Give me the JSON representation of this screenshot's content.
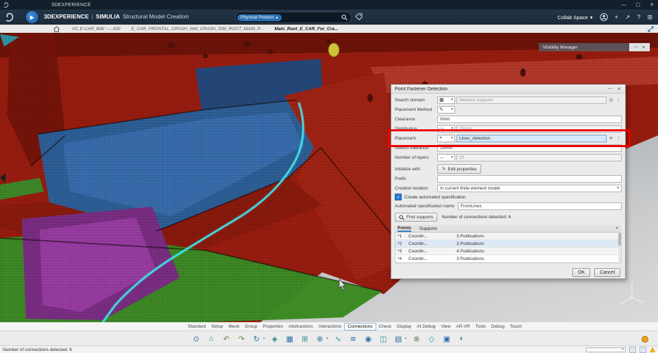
{
  "icons": {
    "caret_down": "▾",
    "kebab": "⋮",
    "gear": "✳",
    "pencil": "✎",
    "minimize": "—",
    "maximize": "▢",
    "close": "✕",
    "check": "✓",
    "funnel": "▼",
    "target": "⌖",
    "swap": "↔",
    "grid": "▦",
    "dash": "▭",
    "plus": "+",
    "share": "↗",
    "help": "?",
    "apps": "⊞",
    "home": "⌂",
    "circle": "◎"
  },
  "titlebar": {
    "app_name": "3DEXPERIENCE"
  },
  "header": {
    "brand": "3DEXPERIENCE",
    "separator": "|",
    "suite": "SIMULIA",
    "app_title": "Structural Model Creation",
    "search_scope": "Physical Product",
    "collab": "Collab Space"
  },
  "tabbar": {
    "tabs": [
      {
        "label": "V2_E-CAR_BiW ----.000"
      },
      {
        "label": "E_CAR_FRONTAL_CRASH_SIM_CRASH_SIM_ROOT_MAIN_P..."
      },
      {
        "label": "Main_Root_E_CAR_For_Cra..."
      }
    ]
  },
  "visibility_manager": {
    "title": "Visibility Manager"
  },
  "dialog": {
    "title": "Point Fastener Detection",
    "fields": {
      "search_domain": {
        "label": "Search domain",
        "value": "Meshed supports"
      },
      "placement_method": {
        "label": "Placement Method"
      },
      "clearance": {
        "label": "Clearance",
        "value": "0mm"
      },
      "distribution": {
        "label": "Distribution",
        "value": "20mm"
      },
      "placement": {
        "label": "Placement",
        "value": "Lines_detection"
      },
      "search_tolerance": {
        "label": "Search tolerance",
        "value": "10mm"
      },
      "number_of_layers": {
        "label": "Number of layers",
        "value": "20"
      },
      "initialize_with": {
        "label": "Initialize with",
        "button": "Edit properties"
      },
      "prefix": {
        "label": "Prefix",
        "value": ""
      },
      "creation_location": {
        "label": "Creation location",
        "value": "In current finite element model"
      },
      "create_automated_spec": {
        "label": "Create automated specification",
        "checked": true
      },
      "auto_spec_name": {
        "label": "Automated specification name",
        "value": "FromLines"
      }
    },
    "find_supports": {
      "button": "Find supports",
      "status": "Number of connections detected: 6"
    },
    "results": {
      "tabs": [
        "Points",
        "Supports"
      ],
      "rows": [
        {
          "id": "*1",
          "name": "Coordin...",
          "info": "3 Publications"
        },
        {
          "id": "*2",
          "name": "Coordin...",
          "info": "3 Publications"
        },
        {
          "id": "*3",
          "name": "Coordin...",
          "info": "4 Publications"
        },
        {
          "id": "*4",
          "name": "Coordin...",
          "info": "3 Publications"
        }
      ]
    },
    "ok": "OK",
    "cancel": "Cancel"
  },
  "ribbon": {
    "tabs": [
      "Standard",
      "Setup",
      "Mesh",
      "Group",
      "Properties",
      "Abstractions",
      "Interactions",
      "Connections",
      "Check",
      "Display",
      "AI Debug",
      "View",
      "AR-VR",
      "Tools",
      "Debug",
      "Touch"
    ],
    "active_tab": "Connections"
  },
  "toolbar": {
    "icons": [
      {
        "name": "zoom-icon",
        "glyph": "⊙"
      },
      {
        "name": "fit-all-icon",
        "glyph": "⌂"
      },
      {
        "name": "undo-icon",
        "glyph": "↶"
      },
      {
        "name": "redo-icon",
        "glyph": "↷"
      },
      {
        "name": "update-icon",
        "glyph": "↻"
      },
      {
        "name": "measure-icon",
        "glyph": "◈"
      },
      {
        "name": "mesh-part-icon",
        "glyph": "▦"
      },
      {
        "name": "grid-icon",
        "glyph": "⊞"
      },
      {
        "name": "point-fastener-icon",
        "glyph": "⊕"
      },
      {
        "name": "curve-fastener-icon",
        "glyph": "∿"
      },
      {
        "name": "seam-weld-icon",
        "glyph": "≋"
      },
      {
        "name": "spot-weld-icon",
        "glyph": "◉"
      },
      {
        "name": "connection-pair-icon",
        "glyph": "◫"
      },
      {
        "name": "section-icon",
        "glyph": "▤"
      },
      {
        "name": "exclude-icon",
        "glyph": "⊗"
      },
      {
        "name": "diamond-icon",
        "glyph": "◇"
      },
      {
        "name": "panel-icon",
        "glyph": "▣"
      },
      {
        "name": "sphere-icon",
        "glyph": "◐"
      }
    ]
  },
  "statusbar": {
    "message": "Number of connections detected: 6"
  }
}
